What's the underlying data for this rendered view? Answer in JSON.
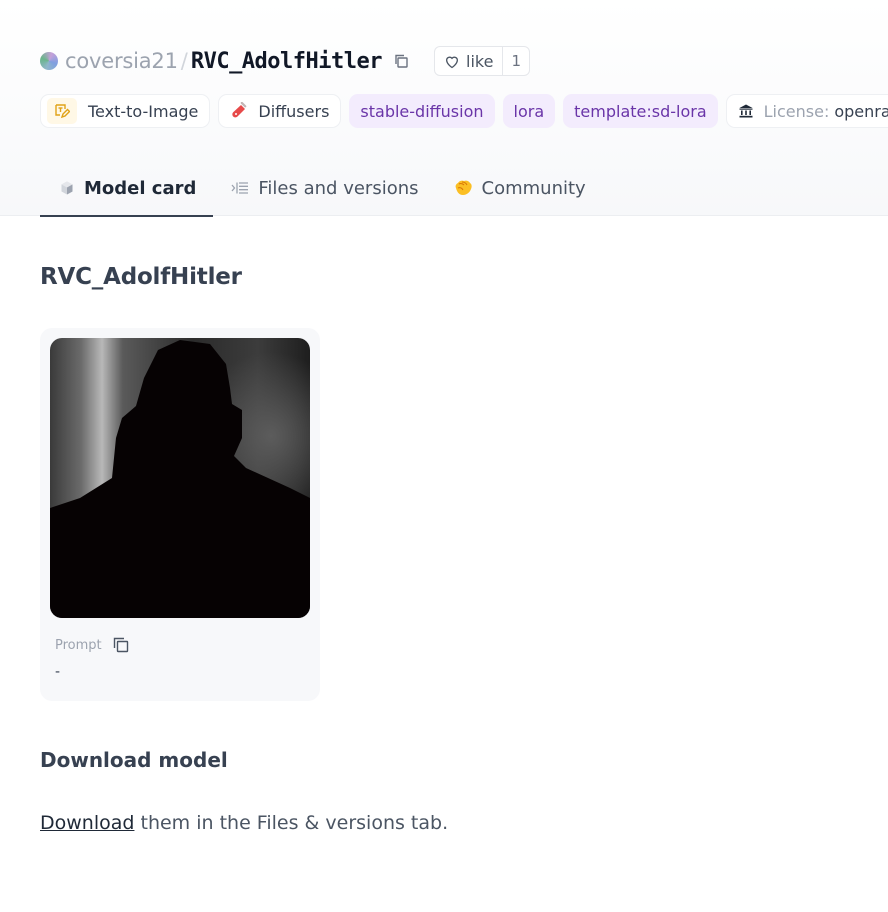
{
  "repo": {
    "owner": "coversia21",
    "separator": "/",
    "name": "RVC_AdolfHitler"
  },
  "like": {
    "label": "like",
    "count": "1"
  },
  "tags": [
    {
      "label": "Text-to-Image",
      "icon": "text-to-image-icon"
    },
    {
      "label": "Diffusers",
      "icon": "diffusers-icon"
    },
    {
      "label": "stable-diffusion"
    },
    {
      "label": "lora"
    },
    {
      "label": "template:sd-lora"
    }
  ],
  "license": {
    "label": "License:",
    "value": "openrail",
    "icon": "bank-icon"
  },
  "tabs": [
    {
      "label": "Model card",
      "icon": "cube-icon",
      "active": true
    },
    {
      "label": "Files and versions",
      "icon": "files-icon"
    },
    {
      "label": "Community",
      "icon": "hand-wave-icon"
    }
  ],
  "card": {
    "title": "RVC_AdolfHitler",
    "gallery": {
      "prompt_label": "Prompt",
      "prompt_value": "-"
    },
    "download_heading": "Download model",
    "download_link": "Download",
    "download_text": " them in the Files & versions tab."
  },
  "colors": {
    "tag_purple_bg": "#f3ecfd",
    "tag_purple_text": "#6a35a8",
    "active_tab_underline": "#374151"
  }
}
